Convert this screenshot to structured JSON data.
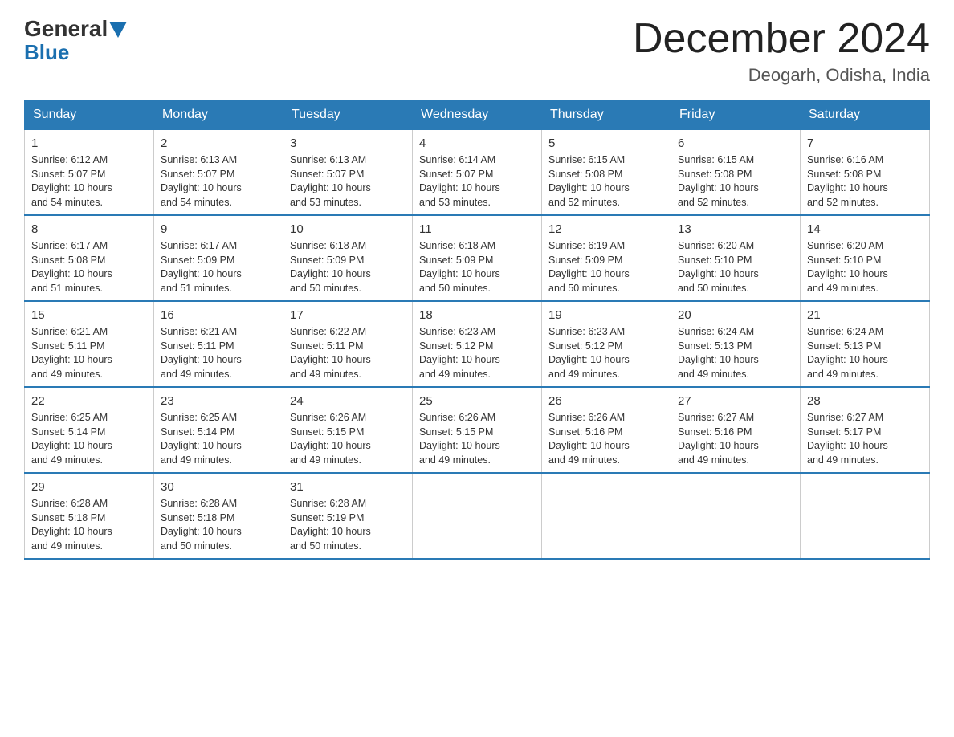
{
  "logo": {
    "general": "General",
    "blue": "Blue"
  },
  "header": {
    "month": "December 2024",
    "location": "Deogarh, Odisha, India"
  },
  "days_of_week": [
    "Sunday",
    "Monday",
    "Tuesday",
    "Wednesday",
    "Thursday",
    "Friday",
    "Saturday"
  ],
  "weeks": [
    [
      {
        "day": "1",
        "sunrise": "6:12 AM",
        "sunset": "5:07 PM",
        "daylight": "10 hours and 54 minutes."
      },
      {
        "day": "2",
        "sunrise": "6:13 AM",
        "sunset": "5:07 PM",
        "daylight": "10 hours and 54 minutes."
      },
      {
        "day": "3",
        "sunrise": "6:13 AM",
        "sunset": "5:07 PM",
        "daylight": "10 hours and 53 minutes."
      },
      {
        "day": "4",
        "sunrise": "6:14 AM",
        "sunset": "5:07 PM",
        "daylight": "10 hours and 53 minutes."
      },
      {
        "day": "5",
        "sunrise": "6:15 AM",
        "sunset": "5:08 PM",
        "daylight": "10 hours and 52 minutes."
      },
      {
        "day": "6",
        "sunrise": "6:15 AM",
        "sunset": "5:08 PM",
        "daylight": "10 hours and 52 minutes."
      },
      {
        "day": "7",
        "sunrise": "6:16 AM",
        "sunset": "5:08 PM",
        "daylight": "10 hours and 52 minutes."
      }
    ],
    [
      {
        "day": "8",
        "sunrise": "6:17 AM",
        "sunset": "5:08 PM",
        "daylight": "10 hours and 51 minutes."
      },
      {
        "day": "9",
        "sunrise": "6:17 AM",
        "sunset": "5:09 PM",
        "daylight": "10 hours and 51 minutes."
      },
      {
        "day": "10",
        "sunrise": "6:18 AM",
        "sunset": "5:09 PM",
        "daylight": "10 hours and 50 minutes."
      },
      {
        "day": "11",
        "sunrise": "6:18 AM",
        "sunset": "5:09 PM",
        "daylight": "10 hours and 50 minutes."
      },
      {
        "day": "12",
        "sunrise": "6:19 AM",
        "sunset": "5:09 PM",
        "daylight": "10 hours and 50 minutes."
      },
      {
        "day": "13",
        "sunrise": "6:20 AM",
        "sunset": "5:10 PM",
        "daylight": "10 hours and 50 minutes."
      },
      {
        "day": "14",
        "sunrise": "6:20 AM",
        "sunset": "5:10 PM",
        "daylight": "10 hours and 49 minutes."
      }
    ],
    [
      {
        "day": "15",
        "sunrise": "6:21 AM",
        "sunset": "5:11 PM",
        "daylight": "10 hours and 49 minutes."
      },
      {
        "day": "16",
        "sunrise": "6:21 AM",
        "sunset": "5:11 PM",
        "daylight": "10 hours and 49 minutes."
      },
      {
        "day": "17",
        "sunrise": "6:22 AM",
        "sunset": "5:11 PM",
        "daylight": "10 hours and 49 minutes."
      },
      {
        "day": "18",
        "sunrise": "6:23 AM",
        "sunset": "5:12 PM",
        "daylight": "10 hours and 49 minutes."
      },
      {
        "day": "19",
        "sunrise": "6:23 AM",
        "sunset": "5:12 PM",
        "daylight": "10 hours and 49 minutes."
      },
      {
        "day": "20",
        "sunrise": "6:24 AM",
        "sunset": "5:13 PM",
        "daylight": "10 hours and 49 minutes."
      },
      {
        "day": "21",
        "sunrise": "6:24 AM",
        "sunset": "5:13 PM",
        "daylight": "10 hours and 49 minutes."
      }
    ],
    [
      {
        "day": "22",
        "sunrise": "6:25 AM",
        "sunset": "5:14 PM",
        "daylight": "10 hours and 49 minutes."
      },
      {
        "day": "23",
        "sunrise": "6:25 AM",
        "sunset": "5:14 PM",
        "daylight": "10 hours and 49 minutes."
      },
      {
        "day": "24",
        "sunrise": "6:26 AM",
        "sunset": "5:15 PM",
        "daylight": "10 hours and 49 minutes."
      },
      {
        "day": "25",
        "sunrise": "6:26 AM",
        "sunset": "5:15 PM",
        "daylight": "10 hours and 49 minutes."
      },
      {
        "day": "26",
        "sunrise": "6:26 AM",
        "sunset": "5:16 PM",
        "daylight": "10 hours and 49 minutes."
      },
      {
        "day": "27",
        "sunrise": "6:27 AM",
        "sunset": "5:16 PM",
        "daylight": "10 hours and 49 minutes."
      },
      {
        "day": "28",
        "sunrise": "6:27 AM",
        "sunset": "5:17 PM",
        "daylight": "10 hours and 49 minutes."
      }
    ],
    [
      {
        "day": "29",
        "sunrise": "6:28 AM",
        "sunset": "5:18 PM",
        "daylight": "10 hours and 49 minutes."
      },
      {
        "day": "30",
        "sunrise": "6:28 AM",
        "sunset": "5:18 PM",
        "daylight": "10 hours and 50 minutes."
      },
      {
        "day": "31",
        "sunrise": "6:28 AM",
        "sunset": "5:19 PM",
        "daylight": "10 hours and 50 minutes."
      },
      null,
      null,
      null,
      null
    ]
  ],
  "labels": {
    "sunrise": "Sunrise:",
    "sunset": "Sunset:",
    "daylight": "Daylight:"
  }
}
